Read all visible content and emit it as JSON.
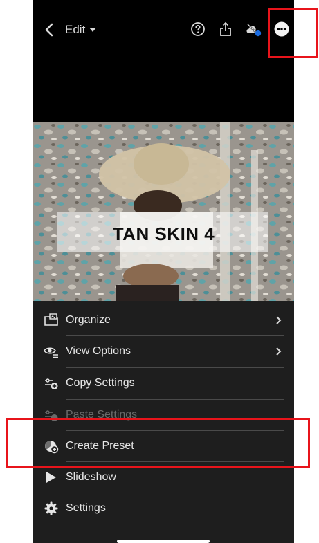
{
  "topbar": {
    "edit_label": "Edit",
    "icons": [
      "back-icon",
      "help-icon",
      "share-icon",
      "cloud-sync-icon",
      "more-options-icon"
    ]
  },
  "photo": {
    "overlay_text": "TAN SKIN 4"
  },
  "menu": {
    "items": [
      {
        "label": "Organize",
        "icon": "organize-icon",
        "has_chevron": true,
        "enabled": true
      },
      {
        "label": "View Options",
        "icon": "view-options-icon",
        "has_chevron": true,
        "enabled": true
      },
      {
        "label": "Copy Settings",
        "icon": "copy-settings-icon",
        "has_chevron": false,
        "enabled": true
      },
      {
        "label": "Paste Settings",
        "icon": "paste-settings-icon",
        "has_chevron": false,
        "enabled": false
      },
      {
        "label": "Create Preset",
        "icon": "create-preset-icon",
        "has_chevron": false,
        "enabled": true
      },
      {
        "label": "Slideshow",
        "icon": "play-icon",
        "has_chevron": false,
        "enabled": true
      },
      {
        "label": "Settings",
        "icon": "gear-icon",
        "has_chevron": false,
        "enabled": true
      }
    ]
  },
  "colors": {
    "background": "#000000",
    "menu_background": "#1e1e1e",
    "highlight": "#e8141b",
    "sync_badge": "#1a6be0"
  }
}
